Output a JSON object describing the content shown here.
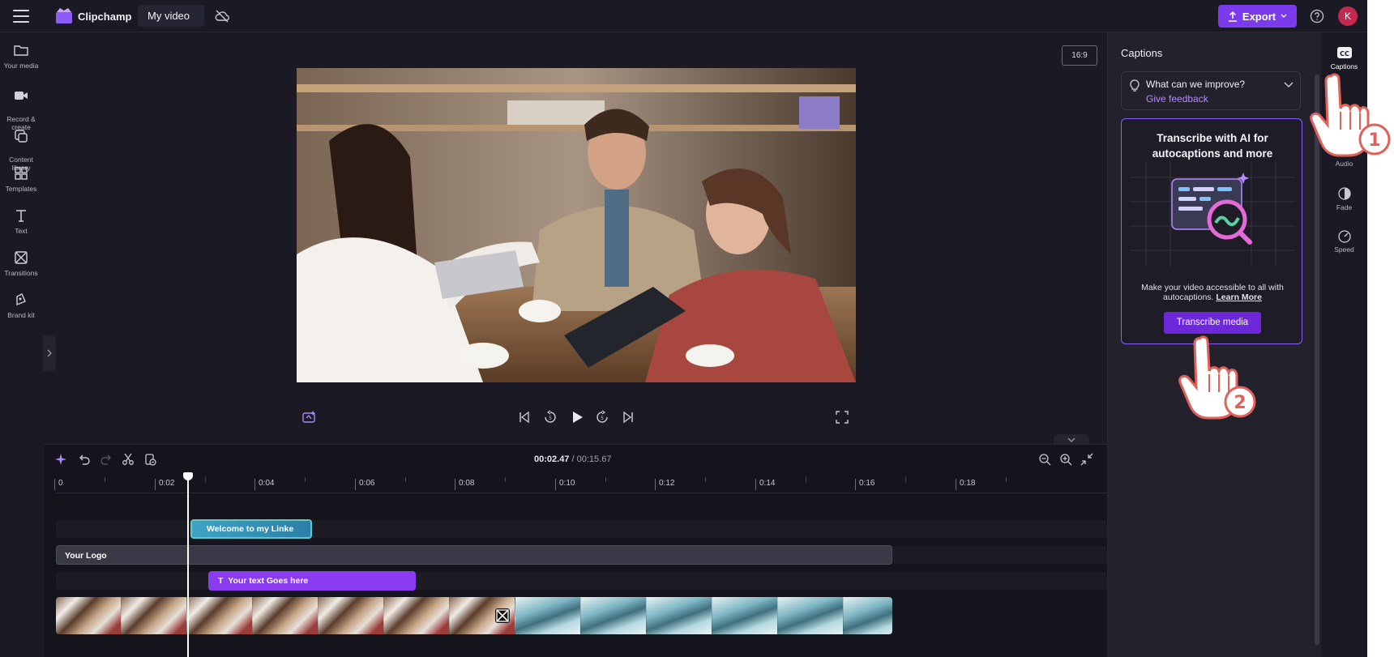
{
  "app": {
    "name": "Clipchamp",
    "project_name": "My video"
  },
  "topbar": {
    "export_label": "Export",
    "avatar_initial": "K"
  },
  "left_nav": [
    {
      "label": "Your media"
    },
    {
      "label": "Record &\ncreate"
    },
    {
      "label": "Content\nlibrary"
    },
    {
      "label": "Templates"
    },
    {
      "label": "Text"
    },
    {
      "label": "Transitions"
    },
    {
      "label": "Brand kit"
    }
  ],
  "preview": {
    "aspect_ratio": "16:9"
  },
  "timeline": {
    "current_time": "00:02.47",
    "total_time": "/ 00:15.67",
    "ruler_labels": [
      "0",
      "0:02",
      "0:04",
      "0:06",
      "0:08",
      "0:10",
      "0:12",
      "0:14",
      "0:16",
      "0:18"
    ],
    "clips": {
      "audio": "Welcome to my Linke",
      "logo": "Your Logo",
      "text": "Your text Goes here"
    }
  },
  "captions_panel": {
    "title": "Captions",
    "feedback_question": "What can we improve?",
    "feedback_link": "Give feedback",
    "card_title": "Transcribe with AI for autocaptions and more",
    "card_desc": "Make your video accessible to all with autocaptions.",
    "learn_more": "Learn More",
    "transcribe_button": "Transcribe media"
  },
  "right_nav": [
    {
      "label": "Captions",
      "active": true
    },
    {
      "label": "Audio"
    },
    {
      "label": "Fade"
    },
    {
      "label": "Speed"
    }
  ],
  "annotations": {
    "step1": "1",
    "step2": "2"
  },
  "colors": {
    "accent": "#7c3aed",
    "background": "#1b1a24",
    "panel": "#22212c"
  }
}
